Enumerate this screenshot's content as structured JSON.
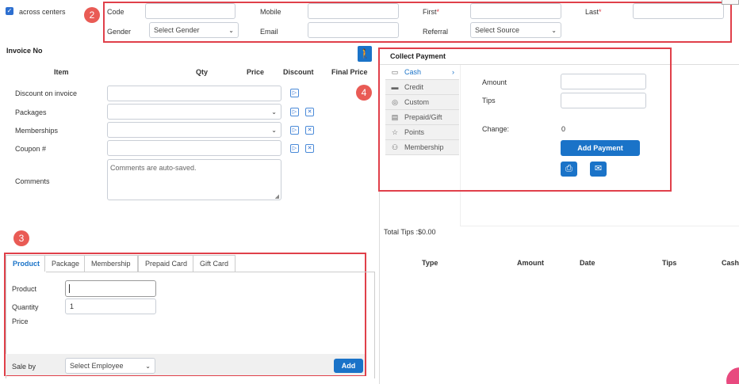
{
  "header": {
    "across_centers_label": "across centers",
    "code_label": "Code",
    "mobile_label": "Mobile",
    "first_label": "First",
    "last_label": "Last",
    "required_mark": "*",
    "gender_label": "Gender",
    "gender_value": "Select Gender",
    "email_label": "Email",
    "referral_label": "Referral",
    "referral_value": "Select Source",
    "badge": "2"
  },
  "invoice": {
    "title": "Invoice No",
    "columns": [
      "Item",
      "Qty",
      "Price",
      "Discount",
      "Final Price"
    ],
    "rows": [
      {
        "label": "Discount on invoice"
      },
      {
        "label": "Packages"
      },
      {
        "label": "Memberships"
      },
      {
        "label": "Coupon #"
      }
    ],
    "comments_label": "Comments",
    "comments_placeholder": "Comments are auto-saved."
  },
  "add_item": {
    "badge": "3",
    "tabs": [
      "Product",
      "Package",
      "Membership",
      "Prepaid Card",
      "Gift Card"
    ],
    "product_label": "Product",
    "quantity_label": "Quantity",
    "quantity_value": "1",
    "price_label": "Price",
    "sale_by_label": "Sale by",
    "employee_value": "Select Employee",
    "add_button": "Add"
  },
  "payment": {
    "badge": "4",
    "title": "Collect Payment",
    "methods": [
      {
        "label": "Cash",
        "icon": "cash-icon",
        "glyph": "▭"
      },
      {
        "label": "Credit",
        "icon": "credit-card-icon",
        "glyph": "▬"
      },
      {
        "label": "Custom",
        "icon": "custom-icon",
        "glyph": "◎"
      },
      {
        "label": "Prepaid/Gift",
        "icon": "gift-card-icon",
        "glyph": "▤"
      },
      {
        "label": "Points",
        "icon": "star-icon",
        "glyph": "☆"
      },
      {
        "label": "Membership",
        "icon": "membership-icon",
        "glyph": "⚇"
      }
    ],
    "amount_label": "Amount",
    "tips_label": "Tips",
    "change_label": "Change:",
    "change_value": "0",
    "add_payment_button": "Add Payment",
    "total_tips": "Total Tips :$0.00",
    "table_columns": [
      "Type",
      "Amount",
      "Date",
      "Tips",
      "Cashi"
    ]
  },
  "colors": {
    "accent": "#1a73c8",
    "annotation": "#e0404a"
  }
}
